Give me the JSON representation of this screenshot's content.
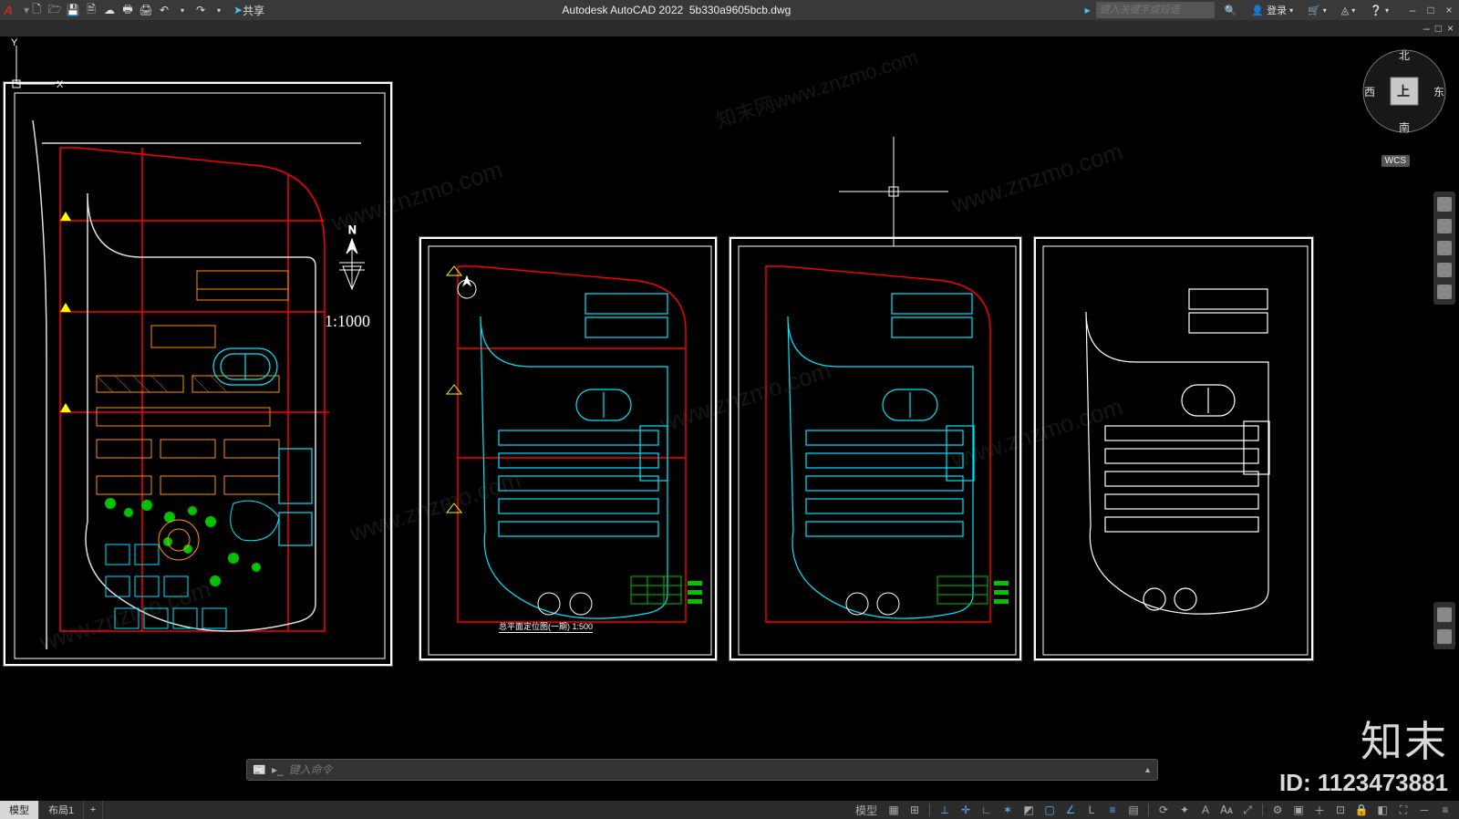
{
  "app": {
    "logo_letter": "A",
    "title_app": "Autodesk AutoCAD 2022",
    "title_file": "5b330a9605bcb.dwg",
    "search_placeholder": "键入关键字或短语",
    "login_label": "登录",
    "share_label": "共享",
    "wcs_label": "WCS"
  },
  "qat_icons": [
    "new",
    "open",
    "save",
    "saveas",
    "cloud",
    "plot",
    "print",
    "undo",
    "undo-drop",
    "redo",
    "redo-drop"
  ],
  "title_right_icons": [
    "cart",
    "app-switcher",
    "help"
  ],
  "win_btns": [
    "–",
    "□",
    "×"
  ],
  "doc_btns": [
    "–",
    "□",
    "×"
  ],
  "viewcube": {
    "n": "北",
    "s": "南",
    "e": "东",
    "w": "西",
    "top": "上"
  },
  "command": {
    "prompt_placeholder": "键入命令"
  },
  "tabs": [
    {
      "label": "模型",
      "active": true
    },
    {
      "label": "布局1",
      "active": false
    }
  ],
  "tab_add": "+",
  "status_left_label": "模型",
  "status_icons": [
    "grid",
    "snap",
    "infer",
    "dyn",
    "ortho",
    "polar",
    "iso",
    "osnap",
    "otrack",
    "ducs",
    "lwt",
    "trans",
    "cycle",
    "3dosnap",
    "ann-vis",
    "ann-auto",
    "ann-scale",
    "wsswitch",
    "monitor",
    "units",
    "qprops",
    "lock",
    "isolate",
    "hw",
    "clean",
    "custom"
  ],
  "sheets": {
    "main_scale": "1:1000",
    "s2_title": "总平面定位图(一期) 1:500"
  },
  "watermark": {
    "brand": "知末",
    "id_label": "ID: 1123473881"
  },
  "diag_text": "www.znzmo.com",
  "chart_data": {
    "type": "cad-layout",
    "description": "AutoCAD model space showing four architectural site-plan drawing sheets of a residential complex. Sheet 1 (large, left) is a colored master site plan at 1:1000 with buildings in orange, landscaping in green, a track/pool in cyan, red property/grid lines, and a north arrow. Sheets 2–4 (right, smaller) are variant site plans of the same complex: sheet 2 titled '总平面定位图(一期) 1:500' with color layers, sheet 3 a similar colored variant, sheet 4 a monochrome white outline version.",
    "sheets": [
      {
        "id": 1,
        "scale": "1:1000",
        "colored": true,
        "has_north_arrow": true
      },
      {
        "id": 2,
        "title": "总平面定位图(一期)",
        "scale": "1:500",
        "colored": true
      },
      {
        "id": 3,
        "colored": true
      },
      {
        "id": 4,
        "colored": false
      }
    ]
  }
}
